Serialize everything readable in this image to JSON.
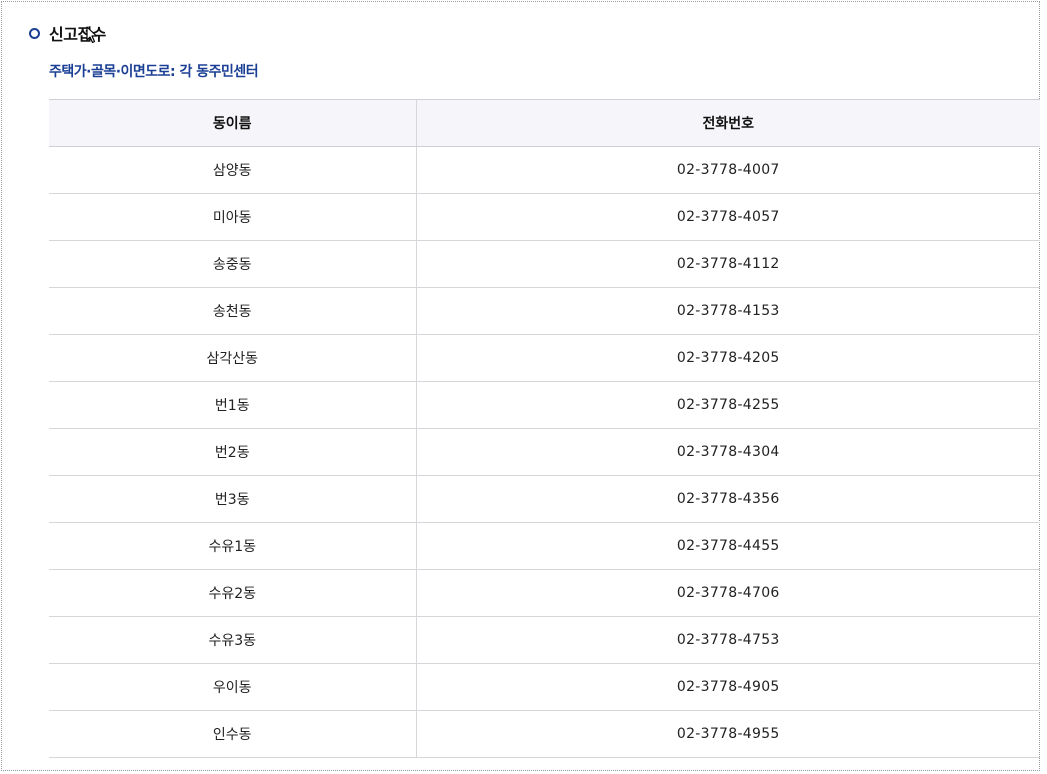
{
  "section": {
    "title": "신고접수",
    "subtitle": "주택가·골목·이면도로: 각 동주민센터"
  },
  "colors": {
    "accent": "#1b3f95",
    "header_bg": "#f6f6fa",
    "border": "#d6d6db"
  },
  "table": {
    "headers": [
      "동이름",
      "전화번호"
    ],
    "rows": [
      {
        "name": "삼양동",
        "phone": "02-3778-4007"
      },
      {
        "name": "미아동",
        "phone": "02-3778-4057"
      },
      {
        "name": "송중동",
        "phone": "02-3778-4112"
      },
      {
        "name": "송천동",
        "phone": "02-3778-4153"
      },
      {
        "name": "삼각산동",
        "phone": "02-3778-4205"
      },
      {
        "name": "번1동",
        "phone": "02-3778-4255"
      },
      {
        "name": "번2동",
        "phone": "02-3778-4304"
      },
      {
        "name": "번3동",
        "phone": "02-3778-4356"
      },
      {
        "name": "수유1동",
        "phone": "02-3778-4455"
      },
      {
        "name": "수유2동",
        "phone": "02-3778-4706"
      },
      {
        "name": "수유3동",
        "phone": "02-3778-4753"
      },
      {
        "name": "우이동",
        "phone": "02-3778-4905"
      },
      {
        "name": "인수동",
        "phone": "02-3778-4955"
      }
    ]
  }
}
